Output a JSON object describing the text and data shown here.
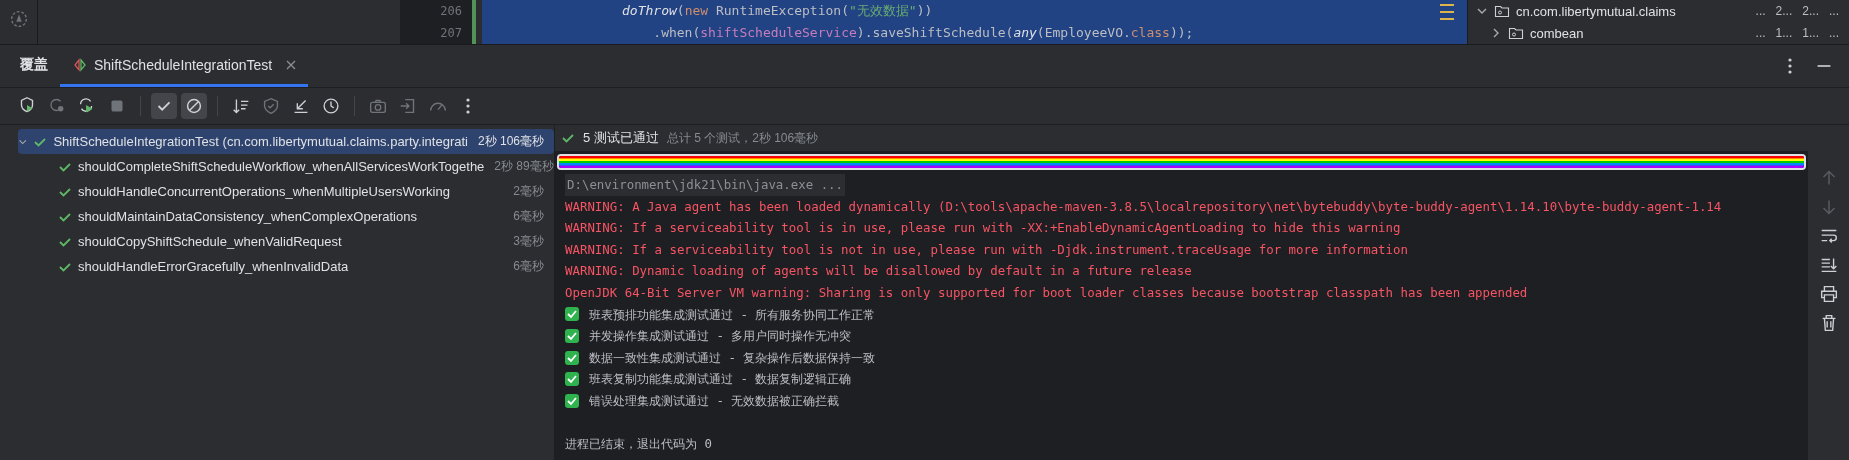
{
  "editor": {
    "lines": [
      {
        "number": "206",
        "code": [
          {
            "kind": "call",
            "text": "doThrow"
          },
          {
            "kind": "plain",
            "text": "("
          },
          {
            "kind": "keyword",
            "text": "new"
          },
          {
            "kind": "plain",
            "text": " RuntimeException("
          },
          {
            "kind": "string",
            "text": "\"无效数据\""
          },
          {
            "kind": "plain",
            "text": "))"
          }
        ]
      },
      {
        "number": "207",
        "code": [
          {
            "kind": "plain",
            "text": "    .when("
          },
          {
            "kind": "field",
            "text": "shiftScheduleService"
          },
          {
            "kind": "plain",
            "text": ").saveShiftSchedule("
          },
          {
            "kind": "call",
            "text": "any"
          },
          {
            "kind": "plain",
            "text": "(EmployeeVO."
          },
          {
            "kind": "keyword",
            "text": "class"
          },
          {
            "kind": "plain",
            "text": "));"
          }
        ]
      }
    ]
  },
  "project_tree": {
    "rows": [
      {
        "label": "cn.com.libertymutual.claims",
        "expanded": true,
        "columns": [
          "...",
          "2...",
          "2...",
          "..."
        ]
      },
      {
        "label": "combean",
        "expanded": false,
        "columns": [
          "...",
          "1...",
          "1...",
          "..."
        ]
      }
    ]
  },
  "tabs": [
    {
      "label": "覆盖",
      "selected": false,
      "closable": false
    },
    {
      "label": "ShiftScheduleIntegrationTest",
      "selected": true,
      "closable": true
    }
  ],
  "toolbar": [
    {
      "kind": "rerun",
      "disabled": false
    },
    {
      "kind": "rerun-failed",
      "disabled": true
    },
    {
      "kind": "toggle-rerun",
      "disabled": false
    },
    {
      "kind": "stop",
      "disabled": true
    },
    {
      "kind": "sep"
    },
    {
      "kind": "show-passed",
      "on": true,
      "disabled": false
    },
    {
      "kind": "show-ignored",
      "on": true,
      "disabled": false
    },
    {
      "kind": "sep"
    },
    {
      "kind": "sort",
      "disabled": false
    },
    {
      "kind": "shield",
      "disabled": true
    },
    {
      "kind": "collapse",
      "disabled": false
    },
    {
      "kind": "history",
      "disabled": false
    },
    {
      "kind": "sep"
    },
    {
      "kind": "camera",
      "disabled": true
    },
    {
      "kind": "import",
      "disabled": true
    },
    {
      "kind": "gauge",
      "disabled": true
    },
    {
      "kind": "more",
      "disabled": false
    }
  ],
  "test_tree": {
    "name": "ShiftScheduleIntegrationTest (cn.com.libertymutual.claims.party.integrati",
    "duration": "2秒 106毫秒",
    "passed": true,
    "expanded": true,
    "selected": true,
    "children": [
      {
        "name": "shouldCompleteShiftScheduleWorkflow_whenAllServicesWorkTogethe",
        "duration": "2秒 89毫秒",
        "passed": true,
        "selected": false
      },
      {
        "name": "shouldHandleConcurrentOperations_whenMultipleUsersWorking",
        "duration": "2毫秒",
        "passed": true,
        "selected": false
      },
      {
        "name": "shouldMaintainDataConsistency_whenComplexOperations",
        "duration": "6毫秒",
        "passed": true,
        "selected": false
      },
      {
        "name": "shouldCopyShiftSchedule_whenValidRequest",
        "duration": "3毫秒",
        "passed": true,
        "selected": false
      },
      {
        "name": "shouldHandleErrorGracefully_whenInvalidData",
        "duration": "6毫秒",
        "passed": true,
        "selected": false
      }
    ]
  },
  "console": {
    "status": {
      "passed": true,
      "summary": "5 测试已通过",
      "detail": "总计 5 个测试，2秒 106毫秒"
    },
    "progress": {
      "level": 1
    },
    "lines": [
      {
        "kind": "command",
        "text": "D:\\environment\\jdk21\\bin\\java.exe ..."
      },
      {
        "kind": "error",
        "text": "WARNING: A Java agent has been loaded dynamically (D:\\tools\\apache-maven-3.8.5\\localrepository\\net\\bytebuddy\\byte-buddy-agent\\1.14.10\\byte-buddy-agent-1.14"
      },
      {
        "kind": "error",
        "text": "WARNING: If a serviceability tool is in use, please run with -XX:+EnableDynamicAgentLoading to hide this warning"
      },
      {
        "kind": "error",
        "text": "WARNING: If a serviceability tool is not in use, please run with -Djdk.instrument.traceUsage for more information"
      },
      {
        "kind": "error",
        "text": "WARNING: Dynamic loading of agents will be disallowed by default in a future release"
      },
      {
        "kind": "error",
        "text": "OpenJDK 64-Bit Server VM warning: Sharing is only supported for boot loader classes because bootstrap classpath has been appended"
      },
      {
        "kind": "check",
        "checked": true,
        "text": "班表预排功能集成测试通过 - 所有服务协同工作正常"
      },
      {
        "kind": "check",
        "checked": true,
        "text": "并发操作集成测试通过 - 多用户同时操作无冲突"
      },
      {
        "kind": "check",
        "checked": true,
        "text": "数据一致性集成测试通过 - 复杂操作后数据保持一致"
      },
      {
        "kind": "check",
        "checked": true,
        "text": "班表复制功能集成测试通过 - 数据复制逻辑正确"
      },
      {
        "kind": "check",
        "checked": true,
        "text": "错误处理集成测试通过 - 无效数据被正确拦截"
      },
      {
        "kind": "blank"
      },
      {
        "kind": "plain",
        "text": "进程已结束，退出代码为 0"
      }
    ]
  },
  "console_toolbar": [
    {
      "kind": "up",
      "disabled": true
    },
    {
      "kind": "down",
      "disabled": true
    },
    {
      "kind": "wrap",
      "disabled": false
    },
    {
      "kind": "scroll-end",
      "disabled": false
    },
    {
      "kind": "print",
      "disabled": false
    },
    {
      "kind": "trash",
      "disabled": false
    }
  ]
}
